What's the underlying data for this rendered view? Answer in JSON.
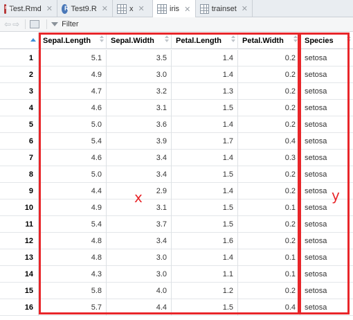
{
  "tabs": [
    {
      "label": "Test.Rmd",
      "icon": "rmd-file-icon",
      "active": false
    },
    {
      "label": "Test9.R",
      "icon": "r-script-icon",
      "active": false
    },
    {
      "label": "x",
      "icon": "data-grid-icon",
      "active": false
    },
    {
      "label": "iris",
      "icon": "data-grid-icon",
      "active": true
    },
    {
      "label": "trainset",
      "icon": "data-grid-icon",
      "active": false
    }
  ],
  "toolbar": {
    "filter_label": "Filter"
  },
  "columns": [
    "Sepal.Length",
    "Sepal.Width",
    "Petal.Length",
    "Petal.Width",
    "Species"
  ],
  "rows": [
    {
      "id": "1",
      "values": [
        "5.1",
        "3.5",
        "1.4",
        "0.2",
        "setosa"
      ]
    },
    {
      "id": "2",
      "values": [
        "4.9",
        "3.0",
        "1.4",
        "0.2",
        "setosa"
      ]
    },
    {
      "id": "3",
      "values": [
        "4.7",
        "3.2",
        "1.3",
        "0.2",
        "setosa"
      ]
    },
    {
      "id": "4",
      "values": [
        "4.6",
        "3.1",
        "1.5",
        "0.2",
        "setosa"
      ]
    },
    {
      "id": "5",
      "values": [
        "5.0",
        "3.6",
        "1.4",
        "0.2",
        "setosa"
      ]
    },
    {
      "id": "6",
      "values": [
        "5.4",
        "3.9",
        "1.7",
        "0.4",
        "setosa"
      ]
    },
    {
      "id": "7",
      "values": [
        "4.6",
        "3.4",
        "1.4",
        "0.3",
        "setosa"
      ]
    },
    {
      "id": "8",
      "values": [
        "5.0",
        "3.4",
        "1.5",
        "0.2",
        "setosa"
      ]
    },
    {
      "id": "9",
      "values": [
        "4.4",
        "2.9",
        "1.4",
        "0.2",
        "setosa"
      ]
    },
    {
      "id": "10",
      "values": [
        "4.9",
        "3.1",
        "1.5",
        "0.1",
        "setosa"
      ]
    },
    {
      "id": "11",
      "values": [
        "5.4",
        "3.7",
        "1.5",
        "0.2",
        "setosa"
      ]
    },
    {
      "id": "12",
      "values": [
        "4.8",
        "3.4",
        "1.6",
        "0.2",
        "setosa"
      ]
    },
    {
      "id": "13",
      "values": [
        "4.8",
        "3.0",
        "1.4",
        "0.1",
        "setosa"
      ]
    },
    {
      "id": "14",
      "values": [
        "4.3",
        "3.0",
        "1.1",
        "0.1",
        "setosa"
      ]
    },
    {
      "id": "15",
      "values": [
        "5.8",
        "4.0",
        "1.2",
        "0.2",
        "setosa"
      ]
    },
    {
      "id": "16",
      "values": [
        "5.7",
        "4.4",
        "1.5",
        "0.4",
        "setosa"
      ]
    }
  ],
  "annotations": {
    "x_label": "x",
    "y_label": "y",
    "color": "#e8262a"
  }
}
